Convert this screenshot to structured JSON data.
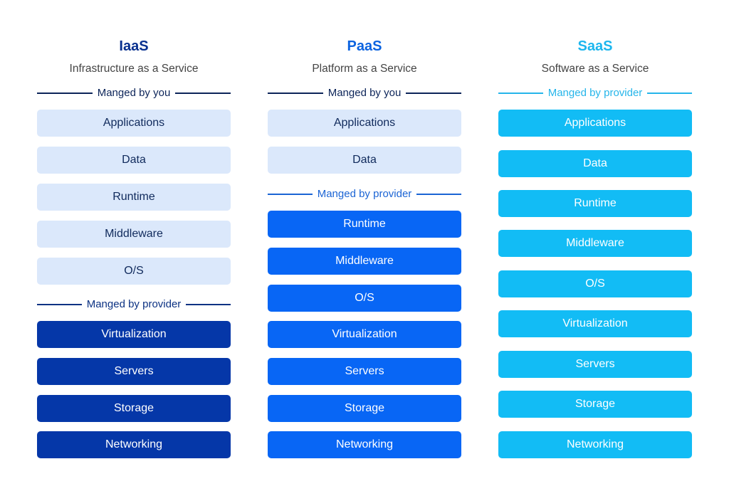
{
  "colors": {
    "iaas_accent": "#0537a8",
    "paas_accent": "#0866f5",
    "saas_accent": "#12bcf5",
    "managed_by_you_fill": "#dbe8fb"
  },
  "columns": [
    {
      "title": "IaaS",
      "subtitle": "Infrastructure as a Service",
      "groups": [
        {
          "label": "Manged by you",
          "items": [
            "Applications",
            "Data",
            "Runtime",
            "Middleware",
            "O/S"
          ]
        },
        {
          "label": "Manged by provider",
          "items": [
            "Virtualization",
            "Servers",
            "Storage",
            "Networking"
          ]
        }
      ]
    },
    {
      "title": "PaaS",
      "subtitle": "Platform as a Service",
      "groups": [
        {
          "label": "Manged by you",
          "items": [
            "Applications",
            "Data"
          ]
        },
        {
          "label": "Manged by provider",
          "items": [
            "Runtime",
            "Middleware",
            "O/S",
            "Virtualization",
            "Servers",
            "Storage",
            "Networking"
          ]
        }
      ]
    },
    {
      "title": "SaaS",
      "subtitle": "Software as a Service",
      "groups": [
        {
          "label": "Manged by provider",
          "items": [
            "Applications",
            "Data",
            "Runtime",
            "Middleware",
            "O/S",
            "Virtualization",
            "Servers",
            "Storage",
            "Networking"
          ]
        }
      ]
    }
  ]
}
